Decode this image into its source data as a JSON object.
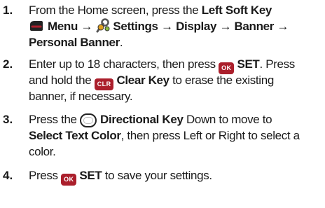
{
  "steps": [
    {
      "number": "1.",
      "line1_prefix": "From the Home screen, press the",
      "line1_bold": "Left Soft Key",
      "menu_label": "Menu",
      "arrow": "→",
      "settings_label": "Settings",
      "display_label": "Display",
      "banner_label": "Banner",
      "personal_banner_label": "Personal Banner",
      "period": "."
    },
    {
      "number": "2.",
      "line1_prefix": "Enter up to 18 characters, then press",
      "ok_key": "OK",
      "set_label": "SET",
      "press_text": ". Press",
      "line2_prefix": "and hold the",
      "clr_key": "CLR",
      "clear_key_label": "Clear Key",
      "line2_suffix": "to erase the existing",
      "line3": "banner, if necessary."
    },
    {
      "number": "3.",
      "line1_prefix": "Press the",
      "directional_key_label": "Directional Key",
      "line1_suffix": "Down to move to",
      "select_text_color_label": "Select Text Color",
      "line2_suffix": ", then press Left or Right to select a",
      "line3": "color."
    },
    {
      "number": "4.",
      "line1_prefix": "Press",
      "ok_key": "OK",
      "set_label": "SET",
      "line1_suffix": "to save your settings."
    }
  ],
  "colors": {
    "key_background": "#ab1f2c",
    "text": "#1a1a1a"
  },
  "icons": [
    "left-soft-key-icon",
    "settings-icon",
    "directional-key-icon"
  ]
}
